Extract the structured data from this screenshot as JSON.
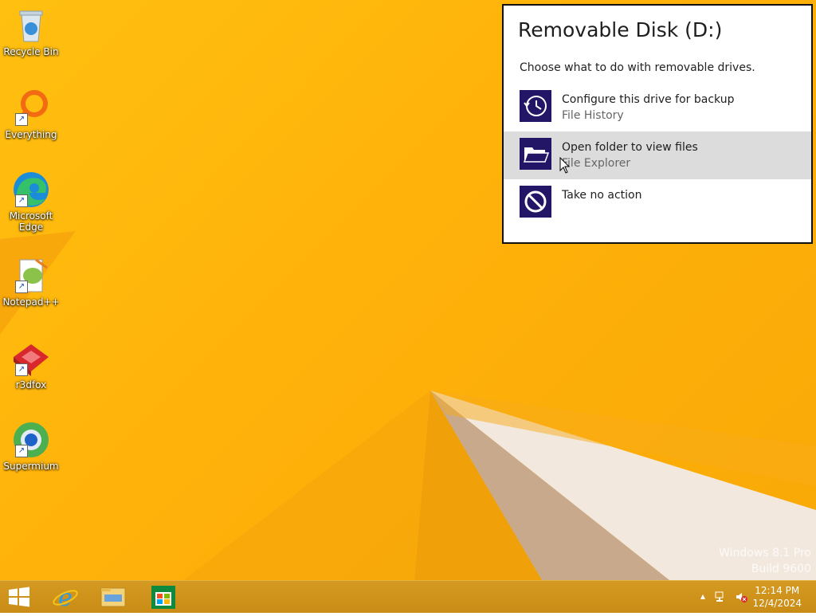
{
  "desktop": {
    "icons": [
      {
        "label": "Recycle Bin",
        "icon": "recycle-bin-icon"
      },
      {
        "label": "Everything",
        "icon": "everything-search-icon"
      },
      {
        "label": "Microsoft Edge",
        "icon": "edge-icon"
      },
      {
        "label": "Notepad++",
        "icon": "notepadpp-icon"
      },
      {
        "label": "r3dfox",
        "icon": "r3dfox-icon"
      },
      {
        "label": "Supermium",
        "icon": "supermium-icon"
      }
    ],
    "watermark": {
      "line1": "Windows 8.1 Pro",
      "line2": "Build 9600"
    }
  },
  "autoplay": {
    "title": "Removable Disk (D:)",
    "subtitle": "Choose what to do with removable drives.",
    "options": [
      {
        "label": "Configure this drive for backup",
        "desc": "File History",
        "icon": "file-history-icon"
      },
      {
        "label": "Open folder to view files",
        "desc": "File Explorer",
        "icon": "open-folder-icon"
      },
      {
        "label": "Take no action",
        "desc": "",
        "icon": "no-action-icon"
      }
    ]
  },
  "taskbar": {
    "buttons": [
      "start-button",
      "internet-explorer",
      "file-explorer",
      "store"
    ],
    "tray": {
      "time": "12:14 PM",
      "date": "12/4/2024"
    }
  },
  "colors": {
    "accent": "#231666",
    "desktop": "#ffb20a",
    "taskbar": "#cf931c"
  }
}
